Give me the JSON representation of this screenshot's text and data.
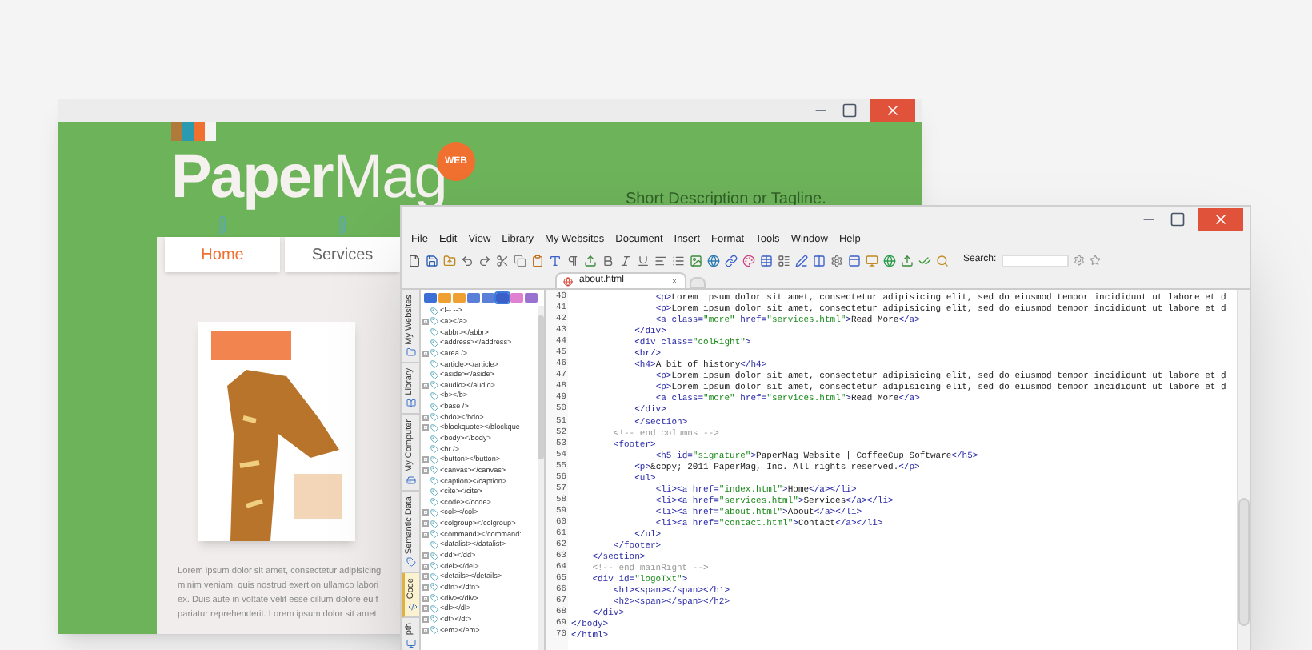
{
  "website_window": {
    "logo": {
      "text": "**Paper**Mag",
      "badge": "WEB"
    },
    "tagline": "Short Description or Tagline.",
    "nav": [
      {
        "label": "Home",
        "selected": true
      },
      {
        "label": "Services",
        "selected": false
      }
    ],
    "body_lines": [
      "Lorem ipsum dolor sit amet, consectetur adipisicing",
      "minim veniam, quis nostrud exertion ullamco labori",
      "ex. Duis aute in voltate velit esse cillum dolore eu f",
      "pariatur reprehenderit. Lorem ipsum dolor sit amet,"
    ]
  },
  "editor_window": {
    "menu": [
      "File",
      "Edit",
      "View",
      "Library",
      "My Websites",
      "Document",
      "Insert",
      "Format",
      "Tools",
      "Window",
      "Help"
    ],
    "search": {
      "label": "Search:"
    },
    "tabs": [
      {
        "label": "about.html",
        "selected": true
      }
    ],
    "side_tabs": [
      {
        "label": "My Websites",
        "selected": false
      },
      {
        "label": "Library",
        "selected": false
      },
      {
        "label": "My Computer",
        "selected": false
      },
      {
        "label": "Semantic Data",
        "selected": false
      },
      {
        "label": "Code",
        "selected": true
      },
      {
        "label": "pth",
        "selected": false
      }
    ],
    "palette": [
      {
        "color": "#3b6fd6",
        "selected": false
      },
      {
        "color": "#f0a030",
        "selected": false
      },
      {
        "color": "#f0a030",
        "selected": false
      },
      {
        "color": "#5a7fd8",
        "selected": false
      },
      {
        "color": "#5a7fd8",
        "selected": false
      },
      {
        "color": "#3a5fc8",
        "selected": true
      },
      {
        "color": "#e080d0",
        "selected": false
      },
      {
        "color": "#9a70d0",
        "selected": false
      }
    ],
    "tree_items": [
      {
        "label": "<!-- -->",
        "expandable": false
      },
      {
        "label": "<a></a>",
        "expandable": true
      },
      {
        "label": "<abbr></abbr>",
        "expandable": false
      },
      {
        "label": "<address></address>",
        "expandable": false
      },
      {
        "label": "<area />",
        "expandable": true
      },
      {
        "label": "<article></article>",
        "expandable": false
      },
      {
        "label": "<aside></aside>",
        "expandable": false
      },
      {
        "label": "<audio></audio>",
        "expandable": true
      },
      {
        "label": "<b></b>",
        "expandable": false
      },
      {
        "label": "<base />",
        "expandable": false
      },
      {
        "label": "<bdo></bdo>",
        "expandable": true
      },
      {
        "label": "<blockquote></blockque",
        "expandable": true
      },
      {
        "label": "<body></body>",
        "expandable": false
      },
      {
        "label": "<br />",
        "expandable": false
      },
      {
        "label": "<button></button>",
        "expandable": true
      },
      {
        "label": "<canvas></canvas>",
        "expandable": true
      },
      {
        "label": "<caption></caption>",
        "expandable": false
      },
      {
        "label": "<cite></cite>",
        "expandable": false
      },
      {
        "label": "<code></code>",
        "expandable": false
      },
      {
        "label": "<col></col>",
        "expandable": true
      },
      {
        "label": "<colgroup></colgroup>",
        "expandable": true
      },
      {
        "label": "<command></command:",
        "expandable": true
      },
      {
        "label": "<datalist></datalist>",
        "expandable": false
      },
      {
        "label": "<dd></dd>",
        "expandable": true
      },
      {
        "label": "<del></del>",
        "expandable": true
      },
      {
        "label": "<details></details>",
        "expandable": true
      },
      {
        "label": "<dfn></dfn>",
        "expandable": true
      },
      {
        "label": "<div></div>",
        "expandable": true
      },
      {
        "label": "<dl></dl>",
        "expandable": true
      },
      {
        "label": "<dt></dt>",
        "expandable": true
      },
      {
        "label": "<em></em>",
        "expandable": true
      }
    ],
    "code": {
      "line_numbers": [
        "40",
        "41",
        "42",
        "43",
        "44",
        "45",
        "46",
        "47",
        "48",
        "49",
        "50",
        "51",
        "52",
        "53",
        "54",
        "55",
        "56",
        "57",
        "58",
        "59",
        "60",
        "61",
        "62",
        "63",
        "64",
        "65",
        "66",
        "67",
        "68",
        "69",
        "70"
      ],
      "lines": [
        "                <p>Lorem ipsum dolor sit amet, consectetur adipisicing elit, sed do eiusmod tempor incididunt ut labore et d",
        "                <p>Lorem ipsum dolor sit amet, consectetur adipisicing elit, sed do eiusmod tempor incididunt ut labore et d",
        "                <a class=\"more\" href=\"services.html\">Read More</a>",
        "            </div>",
        "            <div class=\"colRight\">",
        "            <br/>",
        "            <h4>A bit of history</h4>",
        "                <p>Lorem ipsum dolor sit amet, consectetur adipisicing elit, sed do eiusmod tempor incididunt ut labore et d",
        "                <p>Lorem ipsum dolor sit amet, consectetur adipisicing elit, sed do eiusmod tempor incididunt ut labore et d",
        "                <a class=\"more\" href=\"services.html\">Read More</a>",
        "            </div>",
        "            </section>",
        "        <!-- end columns -->",
        "        <footer>",
        "                <h5 id=\"signature\">PaperMag Website | CoffeeCup Software</h5>",
        "            <p>&copy; 2011 PaperMag, Inc. All rights reserved.</p>",
        "            <ul>",
        "                <li><a href=\"index.html\">Home</a></li>",
        "                <li><a href=\"services.html\">Services</a></li>",
        "                <li><a href=\"about.html\">About</a></li>",
        "                <li><a href=\"contact.html\">Contact</a></li>",
        "            </ul>",
        "        </footer>",
        "    </section>",
        "    <!-- end mainRight -->",
        "    <div id=\"logoTxt\">",
        "        <h1><span></span></h1>",
        "        <h2><span></span></h2>",
        "    </div>",
        "</body>",
        "</html>"
      ]
    }
  }
}
